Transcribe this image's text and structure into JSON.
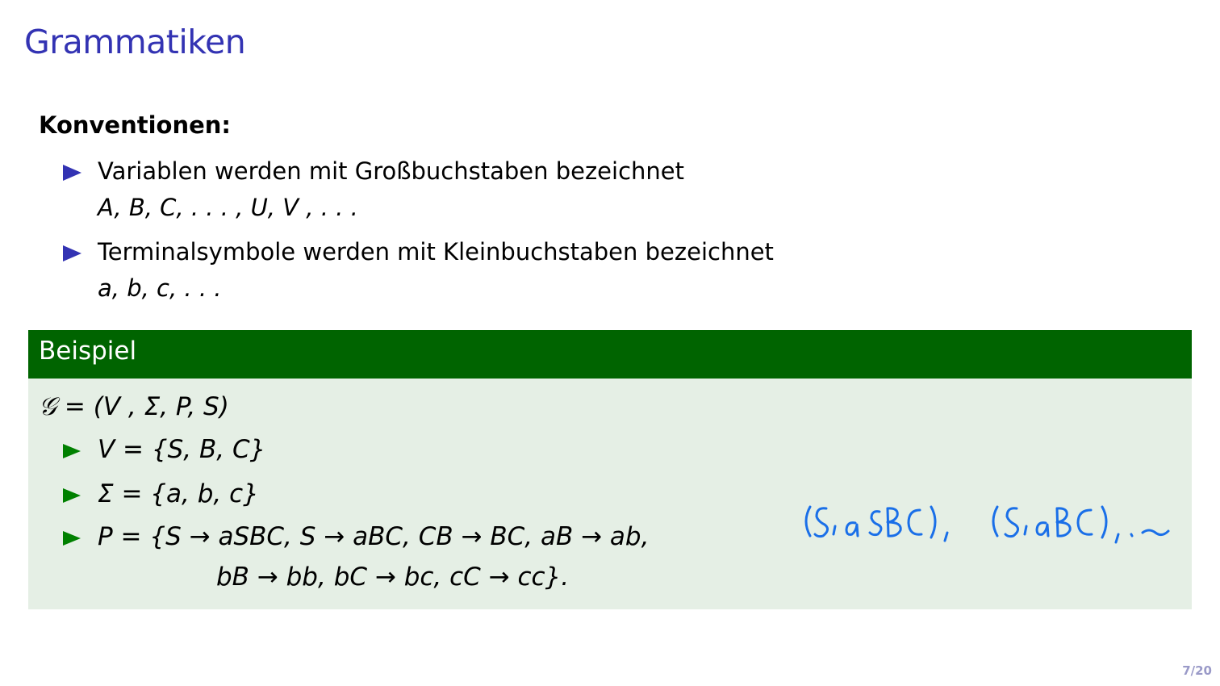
{
  "frame": {
    "title": "Grammatiken",
    "page_number": "7/20"
  },
  "conventions": {
    "heading": "Konventionen:",
    "items": [
      {
        "text": "Variablen werden mit Großbuchstaben bezeichnet",
        "math": "A, B, C, . . . , U, V , . . ."
      },
      {
        "text": "Terminalsymbole werden mit Kleinbuchstaben bezeichnet",
        "math": "a, b, c, . . ."
      }
    ]
  },
  "example": {
    "title": "Beispiel",
    "definition": "𝒢 = (V , Σ, P, S)",
    "items": [
      {
        "line1": "V = {S, B, C}"
      },
      {
        "line1": "Σ = {a, b, c}"
      },
      {
        "line1": "P = {S → aSBC, S → aBC, CB → BC, aB → ab,",
        "line2": "bB → bb, bC → bc, cC → cc}."
      }
    ]
  },
  "annotation": {
    "handwritten": "(S, aSBC), (S, aBC), ..."
  },
  "colors": {
    "title": "#3333b3",
    "bullet": "#3333b3",
    "block_header": "#006400",
    "block_body": "#e5efe5",
    "block_bullet": "#008000",
    "ink": "#1a6fe8",
    "page_number": "#9a9ac8"
  }
}
